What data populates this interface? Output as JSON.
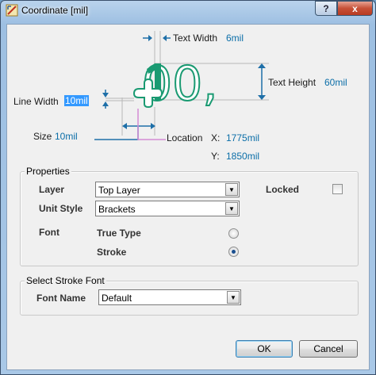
{
  "window": {
    "title": "Coordinate [mil]",
    "help_label": "?",
    "close_label": "x"
  },
  "diagram": {
    "sample_text": "100,",
    "text_width_label": "Text Width",
    "text_width_value": "6mil",
    "text_height_label": "Text Height",
    "text_height_value": "60mil",
    "line_width_label": "Line Width",
    "line_width_value": "10mil",
    "size_label": "Size",
    "size_value": "10mil",
    "location_label": "Location",
    "x_label": "X:",
    "x_value": "1775mil",
    "y_label": "Y:",
    "y_value": "1850mil",
    "accent_color": "#1a9a72"
  },
  "properties": {
    "group_title": "Properties",
    "layer_label": "Layer",
    "layer_value": "Top Layer",
    "locked_label": "Locked",
    "locked_checked": false,
    "unit_style_label": "Unit Style",
    "unit_style_value": "Brackets",
    "font_label": "Font",
    "true_type_label": "True Type",
    "stroke_label": "Stroke",
    "selected_font": "Stroke"
  },
  "stroke_font": {
    "group_title": "Select Stroke Font",
    "font_name_label": "Font Name",
    "font_name_value": "Default"
  },
  "buttons": {
    "ok_label": "OK",
    "cancel_label": "Cancel"
  }
}
